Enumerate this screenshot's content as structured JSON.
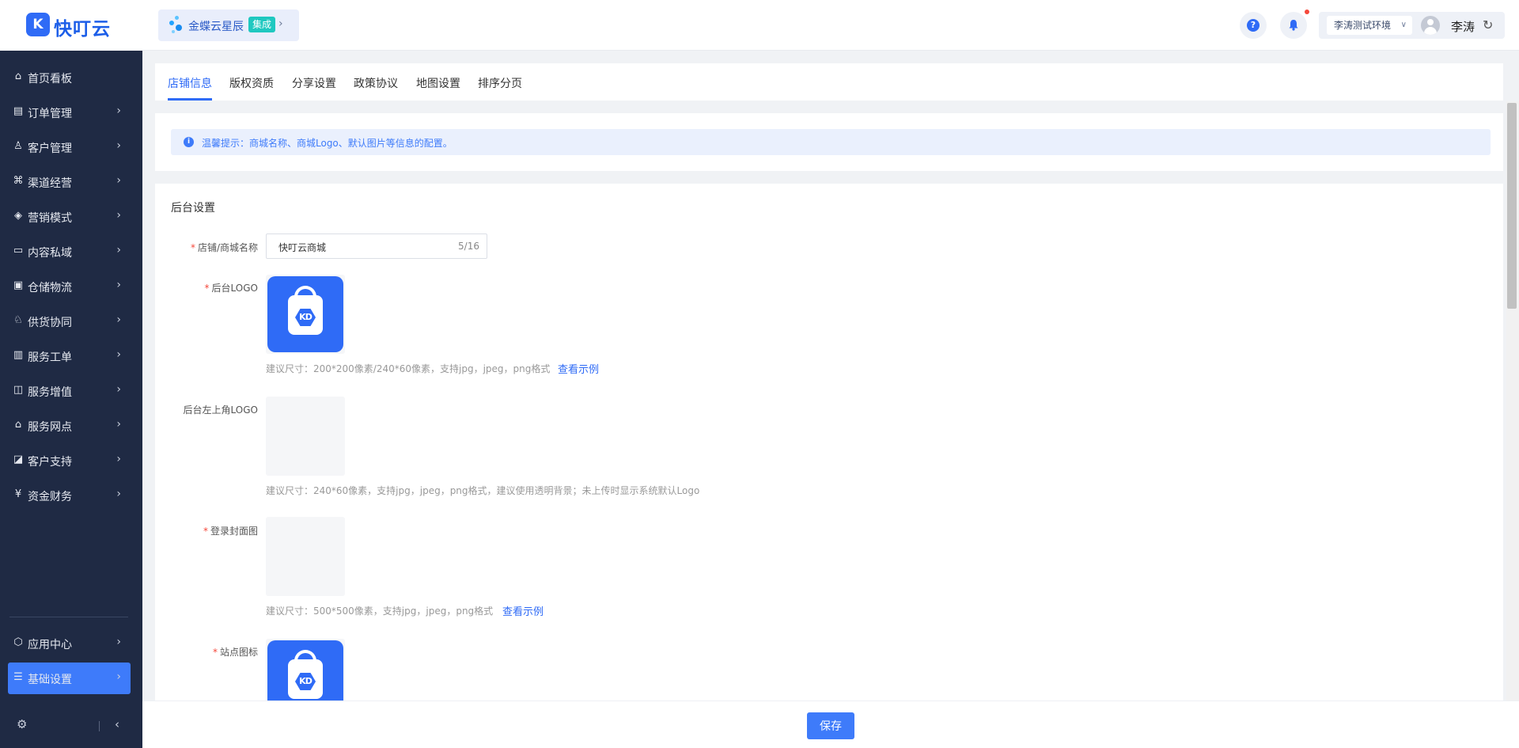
{
  "brand": {
    "logo_glyph": "K",
    "name": "快叮云"
  },
  "app_switch": {
    "label": "金蝶云星辰",
    "tag": "集成"
  },
  "header": {
    "help_glyph": "?",
    "env_select": "李涛测试环境",
    "user_name": "李涛",
    "accent": "#2f6bf6"
  },
  "sidebar": {
    "items": [
      {
        "label": "首页看板",
        "icon": "home-icon",
        "glyph": "⌂",
        "has_arrow": false
      },
      {
        "label": "订单管理",
        "icon": "order-icon",
        "glyph": "▤",
        "has_arrow": true
      },
      {
        "label": "客户管理",
        "icon": "user-icon",
        "glyph": "♙",
        "has_arrow": true
      },
      {
        "label": "渠道经营",
        "icon": "channel-icon",
        "glyph": "⌘",
        "has_arrow": true
      },
      {
        "label": "营销模式",
        "icon": "tag-icon",
        "glyph": "◈",
        "has_arrow": true
      },
      {
        "label": "内容私域",
        "icon": "image-icon",
        "glyph": "▭",
        "has_arrow": true
      },
      {
        "label": "仓储物流",
        "icon": "box-icon",
        "glyph": "▣",
        "has_arrow": true
      },
      {
        "label": "供货协同",
        "icon": "supply-icon",
        "glyph": "♘",
        "has_arrow": true
      },
      {
        "label": "服务工单",
        "icon": "ticket-icon",
        "glyph": "▥",
        "has_arrow": true
      },
      {
        "label": "服务增值",
        "icon": "bag-icon",
        "glyph": "◫",
        "has_arrow": true
      },
      {
        "label": "服务网点",
        "icon": "store-icon",
        "glyph": "⌂",
        "has_arrow": true
      },
      {
        "label": "客户支持",
        "icon": "support-icon",
        "glyph": "◪",
        "has_arrow": true
      },
      {
        "label": "资金财务",
        "icon": "yuan-icon",
        "glyph": "¥",
        "has_arrow": true
      }
    ],
    "bottom_items": [
      {
        "label": "应用中心",
        "icon": "cube-icon",
        "glyph": "⬡"
      },
      {
        "label": "基础设置",
        "icon": "settings-icon",
        "glyph": "☰"
      }
    ],
    "active": "基础设置"
  },
  "tabs": [
    "店铺信息",
    "版权资质",
    "分享设置",
    "政策协议",
    "地图设置",
    "排序分页"
  ],
  "active_tab": "店铺信息",
  "tip": "温馨提示：商城名称、商城Logo、默认图片等信息的配置。",
  "form": {
    "section_title": "后台设置",
    "fields": {
      "shop_name": {
        "label": "店铺/商城名称",
        "value": "快叮云商城",
        "count": "5/16"
      },
      "admin_logo": {
        "label": "后台LOGO",
        "hint": "建议尺寸：200*200像素/240*60像素，支持jpg，jpeg，png格式",
        "link": "查看示例"
      },
      "corner_logo": {
        "label": "后台左上角LOGO",
        "hint": "建议尺寸：240*60像素，支持jpg，jpeg，png格式，建议使用透明背景；未上传时显示系统默认Logo"
      },
      "login_cover": {
        "label": "登录封面图",
        "hint": "建议尺寸：500*500像素，支持jpg，jpeg，png格式",
        "link": "查看示例"
      },
      "site_icon": {
        "label": "站点图标"
      }
    },
    "logo_text": "KD"
  },
  "footer": {
    "save_label": "保存"
  }
}
